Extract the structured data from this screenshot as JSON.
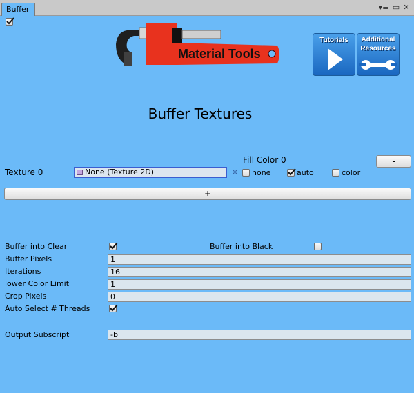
{
  "window": {
    "tab_label": "Buffer",
    "menu_icon": "▾≡",
    "maximize_icon": "▭",
    "close_icon": "✕"
  },
  "header": {
    "logo_text": "Material Tools",
    "tutorials_label": "Tutorials",
    "resources_label_line1": "Additional",
    "resources_label_line2": "Resources",
    "title": "Buffer Textures"
  },
  "textures": {
    "fill_color_label": "Fill Color 0",
    "remove_button_label": "-",
    "texture_label": "Texture 0",
    "texture_value": "None (Texture 2D)",
    "options": [
      {
        "label": "none",
        "checked": false
      },
      {
        "label": "auto",
        "checked": true
      },
      {
        "label": "color",
        "checked": false
      }
    ],
    "add_button_label": "+"
  },
  "settings": {
    "buffer_into_clear_label": "Buffer into Clear",
    "buffer_into_clear": true,
    "buffer_into_black_label": "Buffer into Black",
    "buffer_into_black": false,
    "buffer_pixels_label": "Buffer Pixels",
    "buffer_pixels_value": "1",
    "iterations_label": "Iterations",
    "iterations_value": "16",
    "lower_color_limit_label": "lower Color Limit",
    "lower_color_limit_value": "1",
    "crop_pixels_label": "Crop Pixels",
    "crop_pixels_value": "0",
    "auto_threads_label": "Auto Select # Threads",
    "auto_threads": true,
    "output_subscript_label": "Output Subscript",
    "output_subscript_value": "-b"
  },
  "colors": {
    "background": "#6bbaf8",
    "logo_red": "#e8321e",
    "tile_blue": "#1a67c0"
  },
  "icons": {
    "enable": "checkbox-checked-icon",
    "tutorials": "play-icon",
    "resources": "wrench-icon"
  }
}
